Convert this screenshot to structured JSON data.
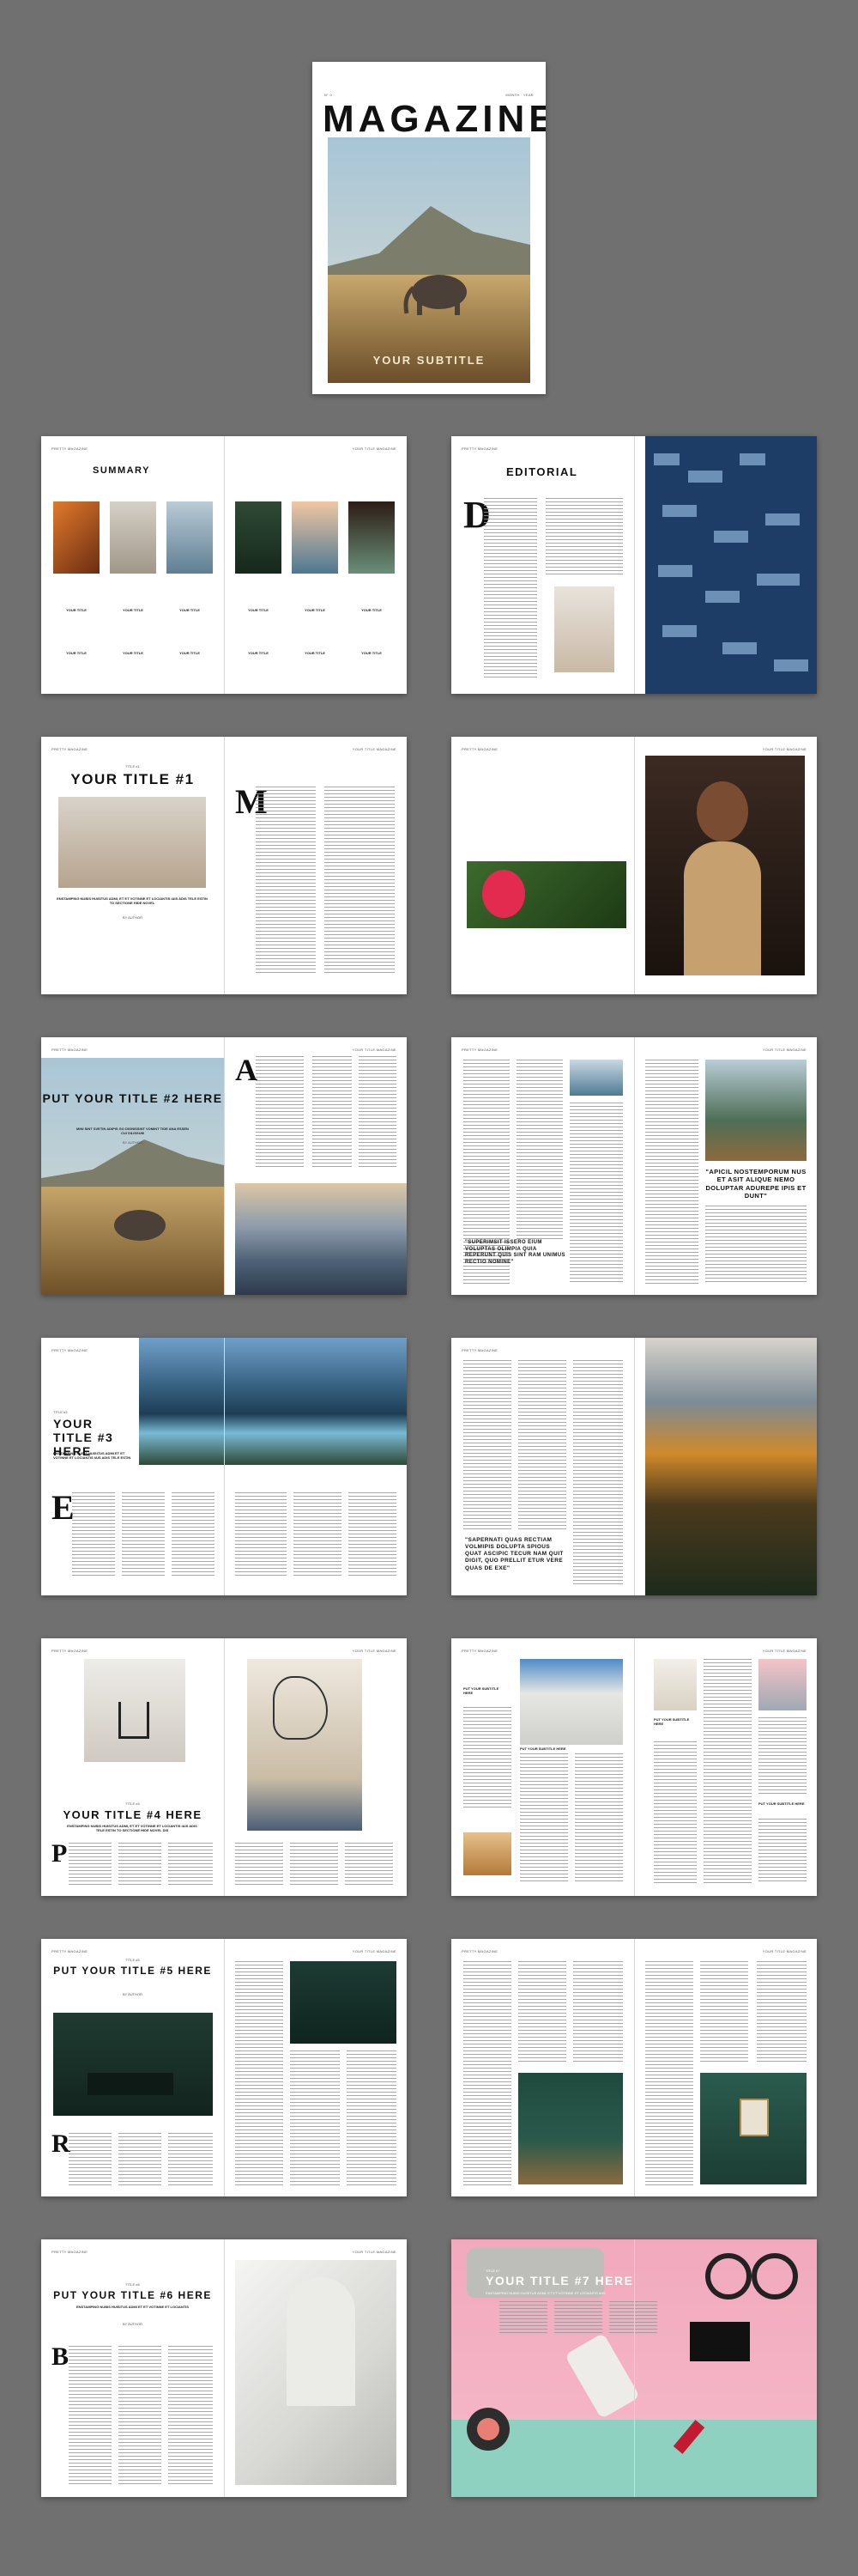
{
  "cover": {
    "issue": "N° 0",
    "date": "MONTH · YEAR",
    "title": "MAGAZINE",
    "subtitle": "YOUR SUBTITLE"
  },
  "running_left": "PRETTY MAGAZINE",
  "running_right": "YOUR TITLE MAGAZINE",
  "summary": {
    "title": "SUMMARY",
    "items": [
      "YOUR TITLE",
      "YOUR TITLE",
      "YOUR TITLE",
      "YOUR TITLE",
      "YOUR TITLE",
      "YOUR TITLE"
    ],
    "items2": [
      "YOUR TITLE",
      "YOUR TITLE",
      "YOUR TITLE",
      "YOUR TITLE",
      "YOUR TITLE",
      "YOUR TITLE"
    ]
  },
  "editorial": {
    "title": "EDITORIAL",
    "dropcap": "D"
  },
  "t1": {
    "kicker": "TITLE #1",
    "title": "YOUR TITLE #1",
    "deck": "ENSTAMPING NUBIS HUISITUS ADMI, ET ET VOTINNE ET LOCIANTIS IAIS ADIS TELE ESTIN TO SECTIONE HIDE NOVEL",
    "byline": "BY AUTHOR",
    "dropcap": "M"
  },
  "t2": {
    "title": "PUT YOUR TITLE #2 HERE",
    "deck": "MINI SINT SVETIN ADIPIS GO DIGNISSINT VOMINT TIDE ANA ESSEN CUI SILISSUM",
    "byline": "BY AUTHOR",
    "dropcap": "A"
  },
  "q1": {
    "text": "\"SUPERIMSIT ISSERO EIUM VOLUPTAS OLIMPIA QUIA REPERUNT QUIS SINT RAM UNIMUS RECTIO NOMINE\""
  },
  "q2": {
    "text": "\"APICIL NOSTEMPORUM NUS ET ASIT ALIQUE NEMO DOLUPTAR ADUREPE IPIS ET DUNT\""
  },
  "t3": {
    "kicker": "TITLE #3",
    "title": "YOUR TITLE #3 HERE",
    "deck": "ENSTAMPING NUBIS HUISITUS ADMI ET ET VOTINNE ET LOCIANTIS IAIS ADIS TELE ESTIN",
    "dropcap": "E"
  },
  "q3": {
    "text": "\"SAPERNATI QUAS RECTIAM VOLMIPIS DOLUPTA SPIOUS QUAT ASCIPIC TECUR NAM QUIT DIGIT, QUO PRELLIT ETUR VERE QUAS DE EXE\""
  },
  "t4": {
    "kicker": "TITLE #4",
    "title": "YOUR TITLE #4 HERE",
    "deck": "ENSTAMPING NUBIS HUISITUS ADMI, ET ET VOTINNE ET LOCIANTIS IAIS ADIS TELE ESTIN TO SECTIONE HIDE NOVEL DIS",
    "dropcap": "P"
  },
  "boxes": {
    "a": "PUT YOUR SUBTITLE HERE",
    "b": "PUT YOUR SUBTITLE HERE",
    "c": "PUT YOUR SUBTITLE HERE",
    "d": "PUT YOUR SUBTITLE HERE",
    "e": "PUT YOUR SUBTITLE HERE"
  },
  "t5": {
    "kicker": "TITLE #5",
    "title": "PUT YOUR TITLE #5 HERE",
    "byline": "BY AUTHOR",
    "dropcap": "R"
  },
  "t6": {
    "kicker": "TITLE #6",
    "title": "PUT YOUR TITLE #6 HERE",
    "deck": "ENSTAMPING NUBIS HUISITUS ADMI ET ET VOTINNE ET LOCIANTIS",
    "byline": "BY AUTHOR",
    "dropcap": "B"
  },
  "t7": {
    "kicker": "TITLE #7",
    "title": "YOUR TITLE #7 HERE",
    "deck": "ENSTAMPING NUBIS HUISITUS ADMI, ET ET VOTINNE ET LOCIANTIS IAIS"
  }
}
